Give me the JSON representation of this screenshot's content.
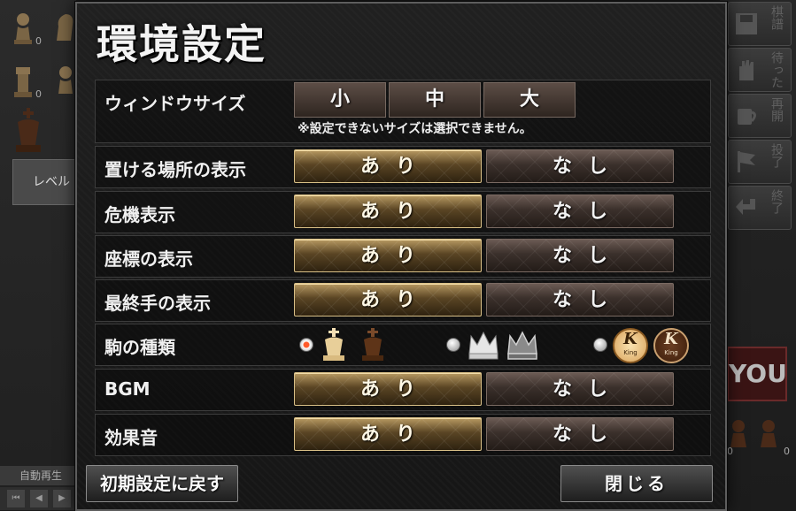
{
  "dialog": {
    "title": "環境設定",
    "window_size": {
      "label": "ウィンドウサイズ",
      "options": [
        "小",
        "中",
        "大"
      ],
      "note": "※設定できないサイズは選択できません。"
    },
    "rows": [
      {
        "label": "置ける場所の表示",
        "on_label": "あり",
        "off_label": "なし",
        "selected": "on"
      },
      {
        "label": "危機表示",
        "on_label": "あり",
        "off_label": "なし",
        "selected": "on"
      },
      {
        "label": "座標の表示",
        "on_label": "あり",
        "off_label": "なし",
        "selected": "on"
      },
      {
        "label": "最終手の表示",
        "on_label": "あり",
        "off_label": "なし",
        "selected": "on"
      }
    ],
    "piece_type": {
      "label": "駒の種類",
      "options": [
        "classic-pieces",
        "crown-pieces",
        "k-token-pieces"
      ],
      "selected_index": 0,
      "token_letter": "K",
      "token_caption": "King"
    },
    "bgm": {
      "label": "BGM",
      "on_label": "あり",
      "off_label": "なし",
      "selected": "on"
    },
    "sound_effects": {
      "label": "効果音",
      "on_label": "あり",
      "off_label": "なし",
      "selected": "on"
    },
    "reset_label": "初期設定に戻す",
    "close_label": "閉じる"
  },
  "background": {
    "captured_counts": [
      "0",
      "0",
      "0",
      "0"
    ],
    "level_label": "レベル",
    "auto_play_label": "自動再生",
    "side_buttons": [
      "棋譜",
      "待った",
      "再開",
      "投了",
      "終了"
    ],
    "you_badge": "YOU",
    "bottom_counts": [
      "0",
      "0"
    ]
  },
  "colors": {
    "on_gold": "#b89a62",
    "off_brown": "#6b5b54",
    "radio_selected": "#ff5a2a"
  }
}
